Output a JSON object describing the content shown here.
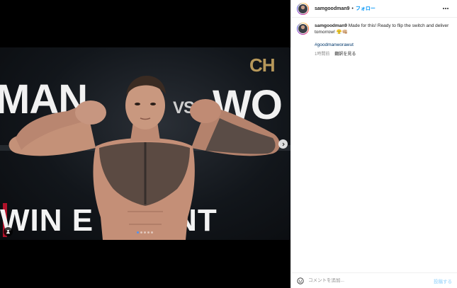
{
  "post": {
    "username": "samgoodman9",
    "separator": "•",
    "follow_label": "フォロー",
    "caption_text": "Made for this! Ready to flip the switch and deliver tomorrow! 😤👊🏼",
    "hashtag": "#goodmanworawut",
    "time_ago": "1時間前",
    "translate_label": "翻訳を見る"
  },
  "media": {
    "banner_ch": "CH",
    "banner_left": "MAN",
    "banner_vs": "VS",
    "banner_right": "WO",
    "banner_bottom": "WIN E    NMENT",
    "carousel_count": 5,
    "carousel_active_index": 0
  },
  "comment": {
    "placeholder": "コメントを追加...",
    "post_label": "投稿する"
  }
}
